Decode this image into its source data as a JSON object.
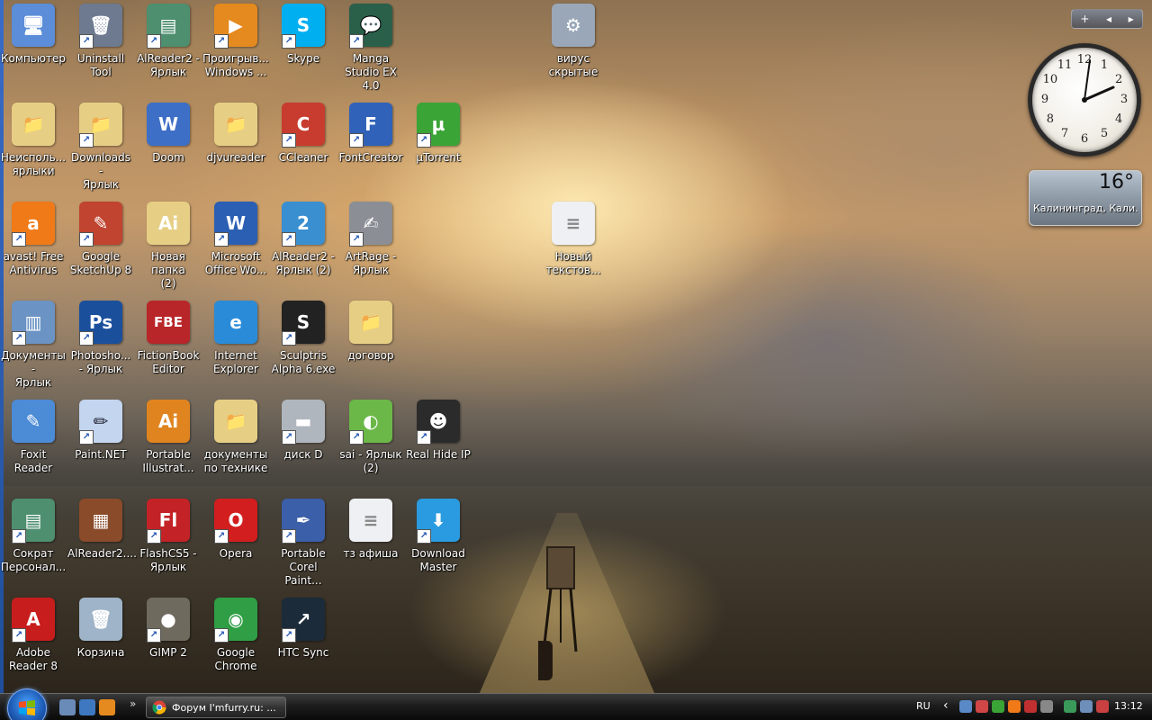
{
  "desktop": {
    "icons": [
      {
        "label": "Компьютер",
        "glyph": "🖥",
        "color": "#5b8dd8"
      },
      {
        "label": "Uninstall\nTool",
        "glyph": "🗑",
        "color": "#6d7a90"
      },
      {
        "label": "AlReader2 -\nЯрлык",
        "glyph": "▤",
        "color": "#4d8f6f"
      },
      {
        "label": "Проигрыв...\nWindows ...",
        "glyph": "▶",
        "color": "#e58a1f"
      },
      {
        "label": "Skype",
        "glyph": "S",
        "color": "#00aff0"
      },
      {
        "label": "Manga\nStudio EX 4.0",
        "glyph": "💬",
        "color": "#2a5f4a"
      },
      {
        "label": "вирус\nскрытые",
        "glyph": "⚙",
        "color": "#9aa7b8"
      },
      {
        "label": "Неисполь...\nярлыки",
        "glyph": "📁",
        "color": "#e6cf85"
      },
      {
        "label": "Downloads -\nЯрлык",
        "glyph": "📁",
        "color": "#e6cf85"
      },
      {
        "label": "Doom",
        "glyph": "W",
        "color": "#3d6fc6"
      },
      {
        "label": "djvureader",
        "glyph": "📁",
        "color": "#e6cf85"
      },
      {
        "label": "CCleaner",
        "glyph": "C",
        "color": "#c73c2f"
      },
      {
        "label": "FontCreator",
        "glyph": "F",
        "color": "#2f62b8"
      },
      {
        "label": "µTorrent",
        "glyph": "µ",
        "color": "#3aa436"
      },
      {
        "label": "avast! Free\nAntivirus",
        "glyph": "a",
        "color": "#f07a18"
      },
      {
        "label": "Google\nSketchUp 8",
        "glyph": "✎",
        "color": "#c0442f"
      },
      {
        "label": "Новая папка\n(2)",
        "glyph": "Ai",
        "color": "#e6cf85"
      },
      {
        "label": "Microsoft\nOffice Wo...",
        "glyph": "W",
        "color": "#2b5fb3"
      },
      {
        "label": "AlReader2 -\nЯрлык (2)",
        "glyph": "2",
        "color": "#3a8fd1"
      },
      {
        "label": "ArtRage -\nЯрлык",
        "glyph": "✍",
        "color": "#8b8f95"
      },
      {
        "label": "Новый\nтекстов...",
        "glyph": "≡",
        "color": "#eef0f3"
      },
      {
        "label": "Документы -\nЯрлык",
        "glyph": "▥",
        "color": "#6b93c4"
      },
      {
        "label": "Photosho...\n- Ярлык",
        "glyph": "Ps",
        "color": "#1a4f9c"
      },
      {
        "label": "FictionBook\nEditor",
        "glyph": "FBE",
        "color": "#b8262a"
      },
      {
        "label": "Internet\nExplorer",
        "glyph": "e",
        "color": "#2a8cd8"
      },
      {
        "label": "Sculptris\nAlpha 6.exe",
        "glyph": "S",
        "color": "#222222"
      },
      {
        "label": "договор",
        "glyph": "📁",
        "color": "#e6cf85"
      },
      {
        "label": "Foxit Reader",
        "glyph": "✎",
        "color": "#4c8bd6"
      },
      {
        "label": "Paint.NET",
        "glyph": "✏",
        "color": "#c3d5ef"
      },
      {
        "label": "Portable\nIllustrat...",
        "glyph": "Ai",
        "color": "#e08420"
      },
      {
        "label": "документы\nпо технике",
        "glyph": "📁",
        "color": "#e6cf85"
      },
      {
        "label": "диск D",
        "glyph": "▬",
        "color": "#b0b6bd"
      },
      {
        "label": "sai - Ярлык\n(2)",
        "glyph": "◐",
        "color": "#6bb848"
      },
      {
        "label": "Real Hide IP",
        "glyph": "☻",
        "color": "#2b2b2b"
      },
      {
        "label": "Сократ\nПерсонал...",
        "glyph": "▤",
        "color": "#4d8f6f"
      },
      {
        "label": "AlReader2....",
        "glyph": "▦",
        "color": "#8a4b2b"
      },
      {
        "label": "FlashCS5 -\nЯрлык",
        "glyph": "Fl",
        "color": "#c32326"
      },
      {
        "label": "Opera",
        "glyph": "O",
        "color": "#d21e1e"
      },
      {
        "label": "Portable\nCorel Paint...",
        "glyph": "✒",
        "color": "#3b5fa8"
      },
      {
        "label": "тз афиша",
        "glyph": "≡",
        "color": "#eef0f3"
      },
      {
        "label": "Download\nMaster",
        "glyph": "⬇",
        "color": "#2a9be0"
      },
      {
        "label": "Adobe\nReader 8",
        "glyph": "A",
        "color": "#c81d1d"
      },
      {
        "label": "Корзина",
        "glyph": "🗑",
        "color": "#9fb4c8"
      },
      {
        "label": "GIMP 2",
        "glyph": "●",
        "color": "#6f6a5e"
      },
      {
        "label": "Google\nChrome",
        "glyph": "◉",
        "color": "#2f9e44"
      },
      {
        "label": "HTC Sync",
        "glyph": "↗",
        "color": "#1c2b3a"
      }
    ]
  },
  "gadgets": {
    "bar_add": "+",
    "bar_prev": "◂",
    "bar_next": "▸",
    "clock_numbers": [
      "12",
      "1",
      "2",
      "3",
      "4",
      "5",
      "6",
      "7",
      "8",
      "9",
      "10",
      "11"
    ],
    "weather_temp": "16°",
    "weather_city": "Калининград, Кали..."
  },
  "taskbar": {
    "chevron": "»",
    "window_title": "Форум I'mfurry.ru: ...",
    "language": "RU",
    "tray_arrow": "‹",
    "time": "13:12"
  },
  "colors": {
    "taskbar_top": "#3a3a3a",
    "taskbar_bottom": "#090909",
    "start_blue": "#1e5cb6",
    "arrow_blue": "#1b4fb0"
  }
}
